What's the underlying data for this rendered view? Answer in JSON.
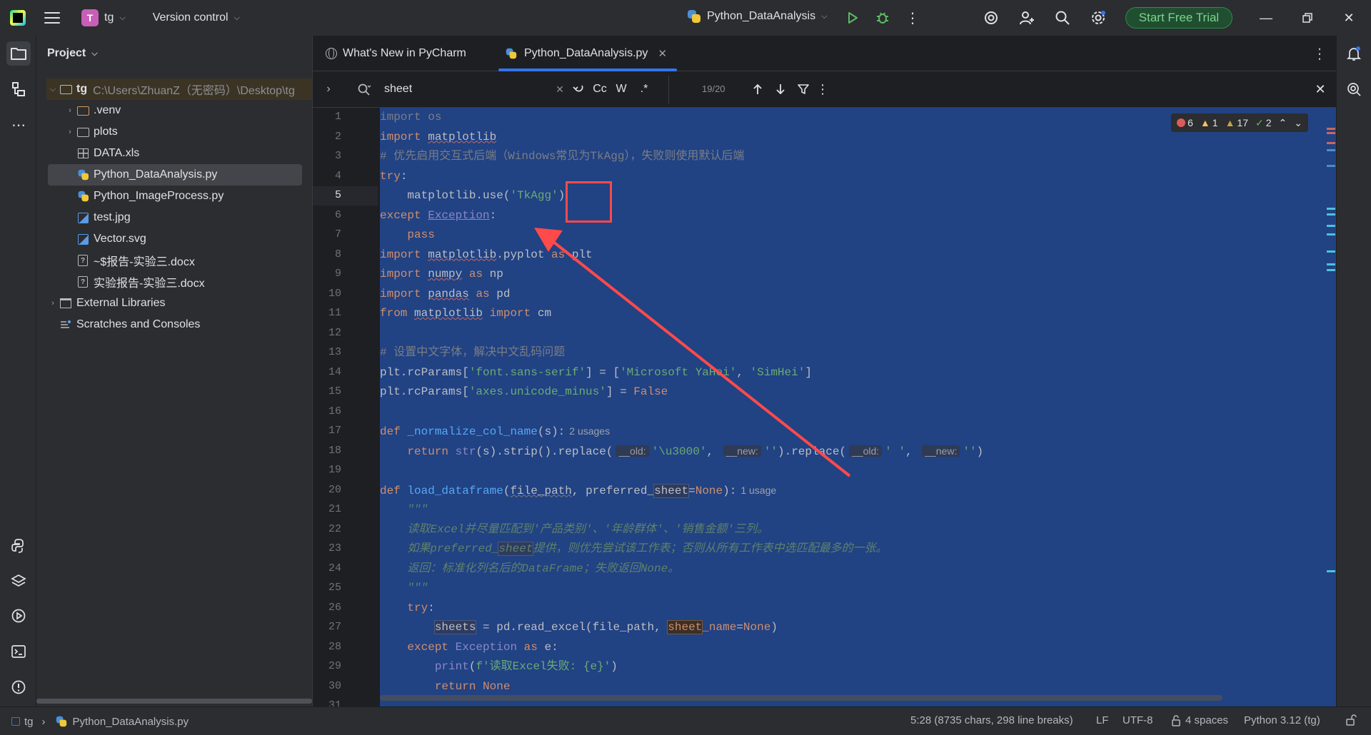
{
  "titlebar": {
    "project_initial": "T",
    "project_name": "tg",
    "vcs_label": "Version control",
    "run_config": "Python_DataAnalysis",
    "trial_button": "Start Free Trial"
  },
  "project_panel": {
    "header": "Project",
    "root_name": "tg",
    "root_path": "C:\\Users\\ZhuanZ（无密码）\\Desktop\\tg",
    "items": [
      {
        "label": ".venv",
        "kind": "folder-orange"
      },
      {
        "label": "plots",
        "kind": "folder"
      },
      {
        "label": "DATA.xls",
        "kind": "table"
      },
      {
        "label": "Python_DataAnalysis.py",
        "kind": "python"
      },
      {
        "label": "Python_ImageProcess.py",
        "kind": "python"
      },
      {
        "label": "test.jpg",
        "kind": "image"
      },
      {
        "label": "Vector.svg",
        "kind": "image"
      },
      {
        "label": "~$报告-实验三.docx",
        "kind": "doc"
      },
      {
        "label": "实验报告-实验三.docx",
        "kind": "doc"
      }
    ],
    "external_libraries": "External Libraries",
    "scratches": "Scratches and Consoles"
  },
  "tabs": [
    {
      "label": "What's New in PyCharm"
    },
    {
      "label": "Python_DataAnalysis.py"
    }
  ],
  "findbar": {
    "query": "sheet",
    "case_label": "Cc",
    "word_label": "W",
    "regex_label": ".*",
    "match_count": "19/20"
  },
  "inspections": {
    "errors": "6",
    "warnings": "1",
    "weak_warnings": "17",
    "ok": "2"
  },
  "code": {
    "line_numbers": [
      "1",
      "2",
      "3",
      "4",
      "5",
      "6",
      "7",
      "8",
      "9",
      "10",
      "11",
      "12",
      "13",
      "14",
      "15",
      "16",
      "17",
      "18",
      "19",
      "20",
      "21",
      "22",
      "23",
      "24",
      "25",
      "26",
      "27",
      "28",
      "29",
      "30",
      "31"
    ],
    "comment3": "# 优先启用交互式后端（Windows常见为TkAgg），失败则使用默认后端",
    "comment13": "# 设置中文字体，解决中文乱码问题",
    "hint17": "2 usages",
    "hint20": "1 usage",
    "doc22": "读取Excel并尽量匹配到'产品类别'、'年龄群体'、'销售金额'三列。",
    "doc23a": "如果preferred_",
    "doc23b": "sheet",
    "doc23c": "提供，则优先尝试该工作表；否则从所有工作表中选匹配最多的一张。",
    "doc24": "返回：标准化列名后的DataFrame；失败返回None。",
    "print29": "f'读取Excel失败: {e}'"
  },
  "statusbar": {
    "crumb_project": "tg",
    "crumb_file": "Python_DataAnalysis.py",
    "position": "5:28 (8735 chars, 298 line breaks)",
    "line_sep": "LF",
    "encoding": "UTF-8",
    "indent": "4 spaces",
    "interpreter": "Python 3.12 (tg)"
  },
  "colors": {
    "accent": "#3574f0",
    "selection": "#214283",
    "annotation": "#ff4a4a",
    "trial_green": "#7fd28e"
  }
}
